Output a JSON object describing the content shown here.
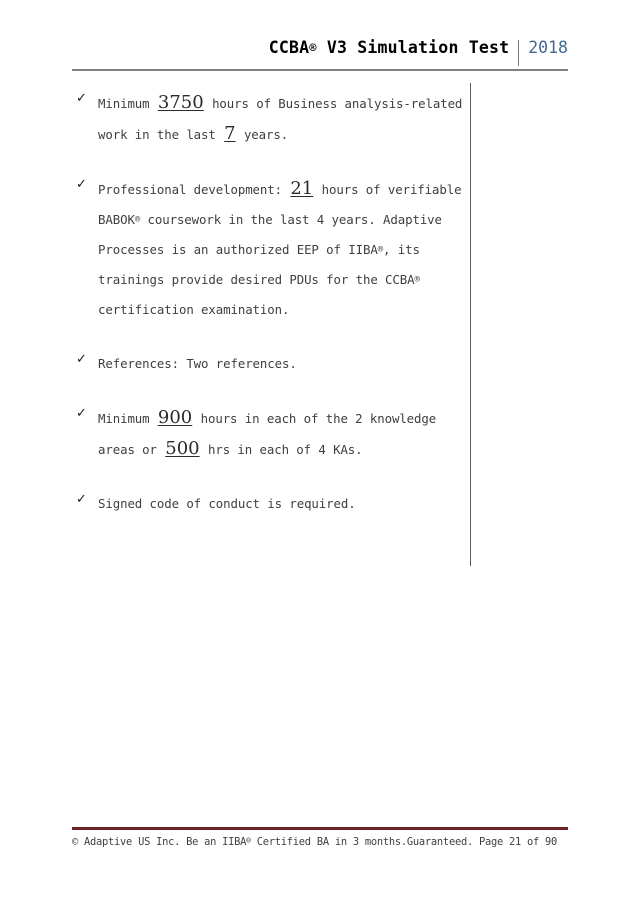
{
  "header": {
    "title": "CCBA® V3 Simulation Test",
    "title_main": "CCBA",
    "title_rest": " V3 Simulation Test",
    "year": "2018"
  },
  "bullets": [
    {
      "icon": "check-icon",
      "segments": [
        {
          "type": "text",
          "value": "Minimum "
        },
        {
          "type": "number",
          "value": "3750"
        },
        {
          "type": "text",
          "value": " hours of Business analysis-related work in the last "
        },
        {
          "type": "number",
          "value": "7"
        },
        {
          "type": "text",
          "value": " years."
        }
      ],
      "plain": "Minimum 3750 hours of Business analysis-related work in the last 7 years."
    },
    {
      "icon": "check-icon",
      "segments": [
        {
          "type": "text",
          "value": "Professional development: "
        },
        {
          "type": "number",
          "value": "21"
        },
        {
          "type": "text",
          "value": " hours of verifiable BABOK® coursework in the last 4 years. Adaptive Processes is an authorized EEP of IIBA®, its trainings provide desired PDUs for the CCBA® certification examination."
        }
      ],
      "plain": "Professional development: 21 hours of verifiable BABOK® coursework in the last 4 years. Adaptive Processes is an authorized EEP of IIBA®, its trainings provide desired PDUs for the CCBA® certification examination."
    },
    {
      "icon": "check-icon",
      "segments": [
        {
          "type": "text",
          "value": "References: Two references."
        }
      ],
      "plain": "References: Two references."
    },
    {
      "icon": "check-icon",
      "segments": [
        {
          "type": "text",
          "value": "Minimum "
        },
        {
          "type": "number",
          "value": "900"
        },
        {
          "type": "text",
          "value": " hours in each of the 2 knowledge areas or "
        },
        {
          "type": "number",
          "value": "500"
        },
        {
          "type": "text",
          "value": " hrs in each of 4 KAs."
        }
      ],
      "plain": "Minimum 900 hours in each of the 2 knowledge areas or 500 hrs in each of 4 KAs."
    },
    {
      "icon": "check-icon",
      "segments": [
        {
          "type": "text",
          "value": "Signed code of conduct is required."
        }
      ],
      "plain": "Signed code of conduct is required."
    }
  ],
  "bullet_glyph": "✓",
  "footer": {
    "text": "© Adaptive US Inc.  Be an IIBA® Certified BA in 3 months.Guaranteed. Page 21 of 90",
    "copyright": "©",
    "company": "Adaptive US Inc.",
    "tagline": "Be an IIBA® Certified BA in 3 months.Guaranteed.",
    "page_label": "Page 21 of 90",
    "page_number": "21",
    "page_total": "90"
  },
  "colors": {
    "header_rule": "#808080",
    "footer_rule": "#6b2323",
    "year_text": "#44688e",
    "body_text": "#3f3f3f",
    "divider": "#5a5a5a"
  }
}
